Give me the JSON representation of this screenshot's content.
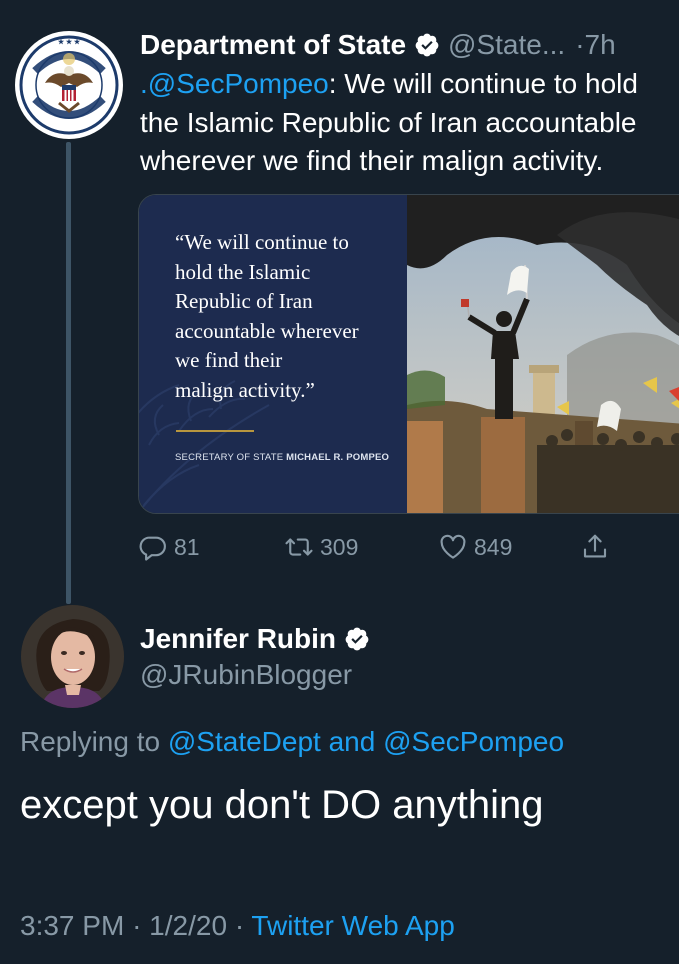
{
  "quoted_tweet": {
    "author_name": "Department of State",
    "author_handle": "@State...",
    "separator": "·",
    "time": "7h",
    "mention": ".@SecPompeo",
    "text_line1": ": We will continue to hold",
    "text_line2": "the Islamic Republic of Iran accountable",
    "text_line3": "wherever we find their malign activity.",
    "media": {
      "quote_text": "“We will continue to\nhold the Islamic\nRepublic of Iran\naccountable wherever\nwe find their\nmalign activity.”",
      "attribution_title": "SECRETARY OF STATE",
      "attribution_name": "MICHAEL R. POMPEO"
    },
    "replies": "81",
    "retweets": "309",
    "likes": "849"
  },
  "reply": {
    "author_name": "Jennifer Rubin",
    "author_handle": "@JRubinBlogger",
    "replying_prefix": "Replying to",
    "replying_to_1": "@StateDept",
    "replying_and": "and",
    "replying_to_2": "@SecPompeo",
    "text": "except you don't DO anything",
    "time": "3:37 PM",
    "date": "1/2/20",
    "separator": "·",
    "source": "Twitter Web App"
  },
  "colors": {
    "background": "#15202b",
    "link": "#1da1f2",
    "muted": "#8899a6",
    "thread_line": "#3d5466"
  },
  "icons": [
    "seal-icon",
    "verified-icon",
    "reply-icon",
    "retweet-icon",
    "like-icon",
    "share-icon"
  ]
}
